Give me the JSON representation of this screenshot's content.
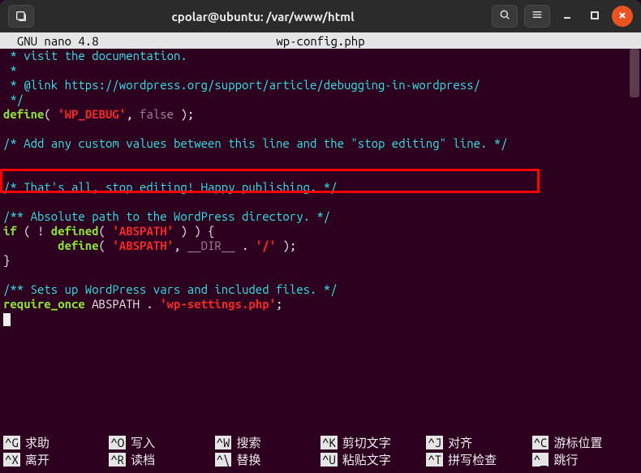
{
  "title": "cpolar@ubuntu: /var/www/html",
  "nano": {
    "version_line": "  GNU nano 4.8",
    "filename": "wp-config.php"
  },
  "code": {
    "l1": " * visit the documentation.",
    "l2": " *",
    "l3_a": " * ",
    "l3_b": "@link https://wordpress.org/support/article/debugging-in-wordpress/",
    "l4": " */",
    "l5_a": "define",
    "l5_b": "( ",
    "l5_c": "'WP_DEBUG'",
    "l5_d": ", ",
    "l5_e": "false",
    "l5_f": " );",
    "l7": "/* Add any custom values between this line and the \"stop editing\" line. */",
    "l10": "/* That's all, stop editing! Happy publishing. */",
    "l12": "/** Absolute path to the WordPress directory. */",
    "l13_a": "if",
    "l13_b": " ( ! ",
    "l13_c": "defined",
    "l13_d": "( ",
    "l13_e": "'ABSPATH'",
    "l13_f": " ) ) {",
    "l14_a": "        ",
    "l14_b": "define",
    "l14_c": "( ",
    "l14_d": "'ABSPATH'",
    "l14_e": ", ",
    "l14_f": "__DIR__",
    "l14_g": " . ",
    "l14_h": "'/'",
    "l14_i": " );",
    "l15": "}",
    "l17": "/** Sets up WordPress vars and included files. */",
    "l18_a": "require_once",
    "l18_b": " ABSPATH . ",
    "l18_c": "'wp-settings.php'",
    "l18_d": ";"
  },
  "help": {
    "r1": [
      {
        "key": "^G",
        "label": "求助"
      },
      {
        "key": "^O",
        "label": "写入"
      },
      {
        "key": "^W",
        "label": "搜索"
      },
      {
        "key": "^K",
        "label": "剪切文字"
      },
      {
        "key": "^J",
        "label": "对齐"
      },
      {
        "key": "^C",
        "label": "游标位置"
      }
    ],
    "r2": [
      {
        "key": "^X",
        "label": "离开"
      },
      {
        "key": "^R",
        "label": "读档"
      },
      {
        "key": "^\\",
        "label": "替换"
      },
      {
        "key": "^U",
        "label": "粘贴文字"
      },
      {
        "key": "^T",
        "label": "拼写检查"
      },
      {
        "key": "^_",
        "label": "跳行"
      }
    ]
  }
}
